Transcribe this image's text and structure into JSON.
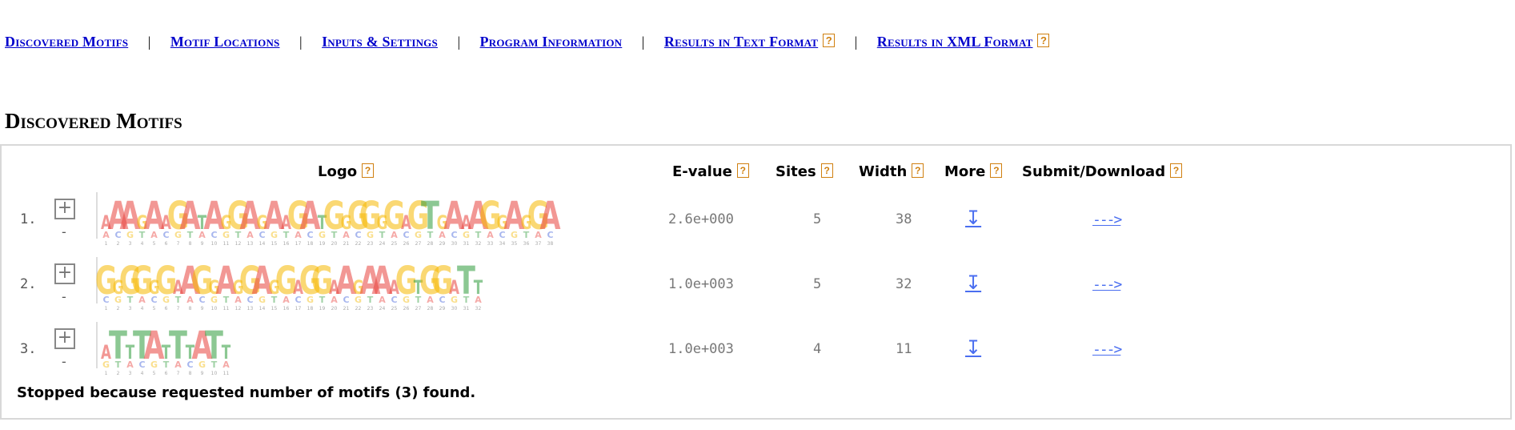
{
  "nav": {
    "items": [
      {
        "label": "Discovered Motifs",
        "help": false
      },
      {
        "label": "Motif Locations",
        "help": false
      },
      {
        "label": "Inputs & Settings",
        "help": false
      },
      {
        "label": "Program Information",
        "help": false
      },
      {
        "label": "Results in Text Format",
        "help": true
      },
      {
        "label": "Results in XML Format",
        "help": true
      }
    ],
    "separator": "|"
  },
  "help_glyph": "?",
  "section_title": "Discovered Motifs",
  "table": {
    "headers": {
      "logo": "Logo",
      "evalue": "E-value",
      "sites": "Sites",
      "width": "Width",
      "more": "More",
      "submit": "Submit/Download"
    },
    "expand_glyph": "+",
    "collapse_glyph": "-",
    "more_glyph": "↧",
    "submit_glyph": "--->",
    "rows": [
      {
        "num": "1.",
        "evalue": "2.6e+000",
        "sites": "5",
        "width": "38",
        "logo": {
          "columns": 38,
          "letters": "AAAGAAGATAGGAGAAGATGGGGGGAGTGAAAGGAGGA"
        }
      },
      {
        "num": "2.",
        "evalue": "1.0e+003",
        "sites": "5",
        "width": "32",
        "logo": {
          "columns": 32,
          "letters": "GGGGGGAAGGAGGAGGAGGAAGAAAGTGGATT"
        }
      },
      {
        "num": "3.",
        "evalue": "1.0e+003",
        "sites": "4",
        "width": "11",
        "logo": {
          "columns": 11,
          "letters": "ATTTATTTATT"
        }
      }
    ],
    "footer": "Stopped because requested number of motifs (3) found."
  },
  "logo_colors": {
    "A": "#e8413c",
    "C": "#3b5ed9",
    "G": "#f5b800",
    "T": "#2e9b3a"
  }
}
